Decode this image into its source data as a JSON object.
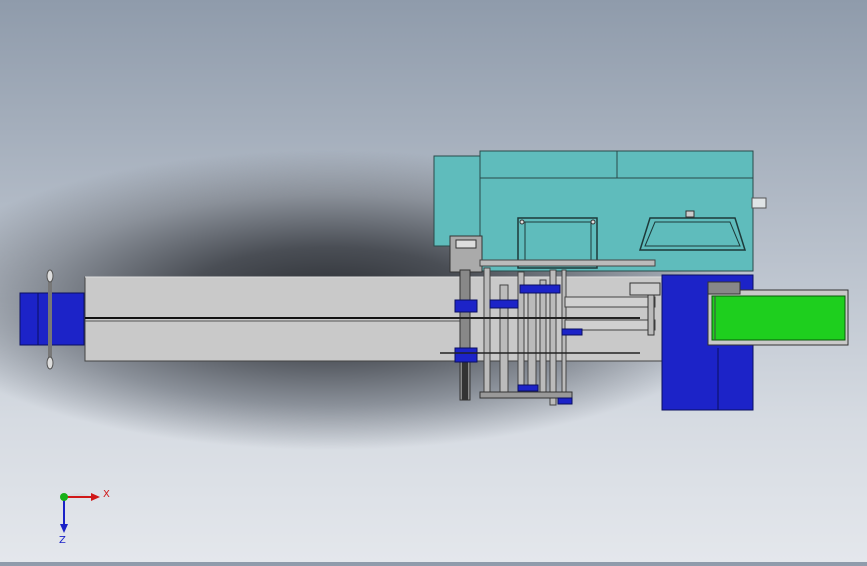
{
  "viewport": {
    "background_top": "#8f9bab",
    "background_bottom": "#e4e7ec",
    "shadow_color": "#2b2e33"
  },
  "model": {
    "colors": {
      "housing_teal": "#5fbcbc",
      "conveyor_gray": "#c8c8c8",
      "motor_blue": "#1c23c8",
      "belt_green": "#1ecf1e",
      "frame_dark": "#2a2f5a"
    }
  },
  "triad": {
    "x_label": "X",
    "z_label": "Z",
    "x_color": "#d01818",
    "z_color": "#1a22c8",
    "origin_color": "#18b018"
  }
}
